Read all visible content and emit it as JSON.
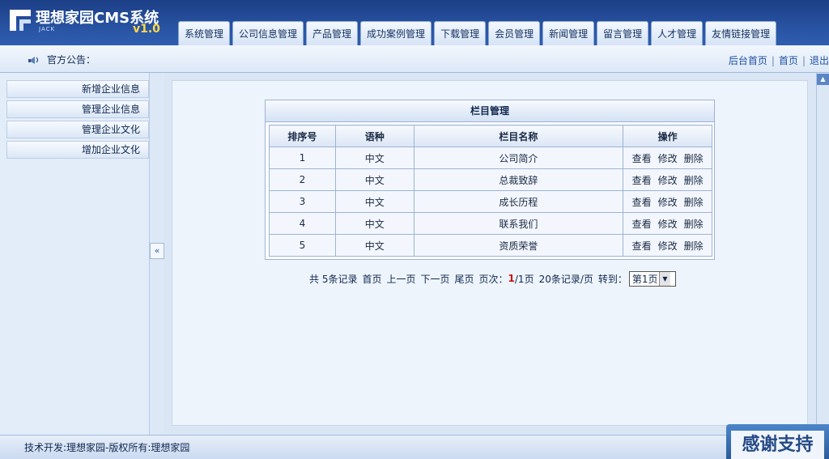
{
  "app": {
    "title": "理想家园CMS系统",
    "subtitle": "JACK",
    "version": "v1.0"
  },
  "nav": {
    "tabs": [
      "系统管理",
      "公司信息管理",
      "产品管理",
      "成功案例管理",
      "下载管理",
      "会员管理",
      "新闻管理",
      "留言管理",
      "人才管理",
      "友情链接管理"
    ]
  },
  "notice": {
    "label": "官方公告："
  },
  "top_links": [
    "后台首页",
    "首页",
    "退出"
  ],
  "sidebar": {
    "items": [
      "新增企业信息",
      "管理企业信息",
      "管理企业文化",
      "增加企业文化"
    ],
    "collapse_label": "«"
  },
  "panel": {
    "title": "栏目管理",
    "columns": [
      "排序号",
      "语种",
      "栏目名称",
      "操作"
    ],
    "rows": [
      {
        "order": "1",
        "lang": "中文",
        "name": "公司简介"
      },
      {
        "order": "2",
        "lang": "中文",
        "name": "总裁致辞"
      },
      {
        "order": "3",
        "lang": "中文",
        "name": "成长历程"
      },
      {
        "order": "4",
        "lang": "中文",
        "name": "联系我们"
      },
      {
        "order": "5",
        "lang": "中文",
        "name": "资质荣誉"
      }
    ],
    "actions": [
      "查看",
      "修改",
      "删除"
    ]
  },
  "pager": {
    "total": "共  5条记录",
    "first": "首页",
    "prev": "上一页",
    "next": "下一页",
    "last": "尾页",
    "page_label": "页次：",
    "current": "1",
    "total_pages": "/1页",
    "per_page": "20条记录/页",
    "goto_label": "转到：",
    "select_value": "第1页"
  },
  "footer": {
    "text": "技术开发:理想家园-版权所有:理想家园"
  },
  "badge": {
    "text": "感谢支持"
  }
}
